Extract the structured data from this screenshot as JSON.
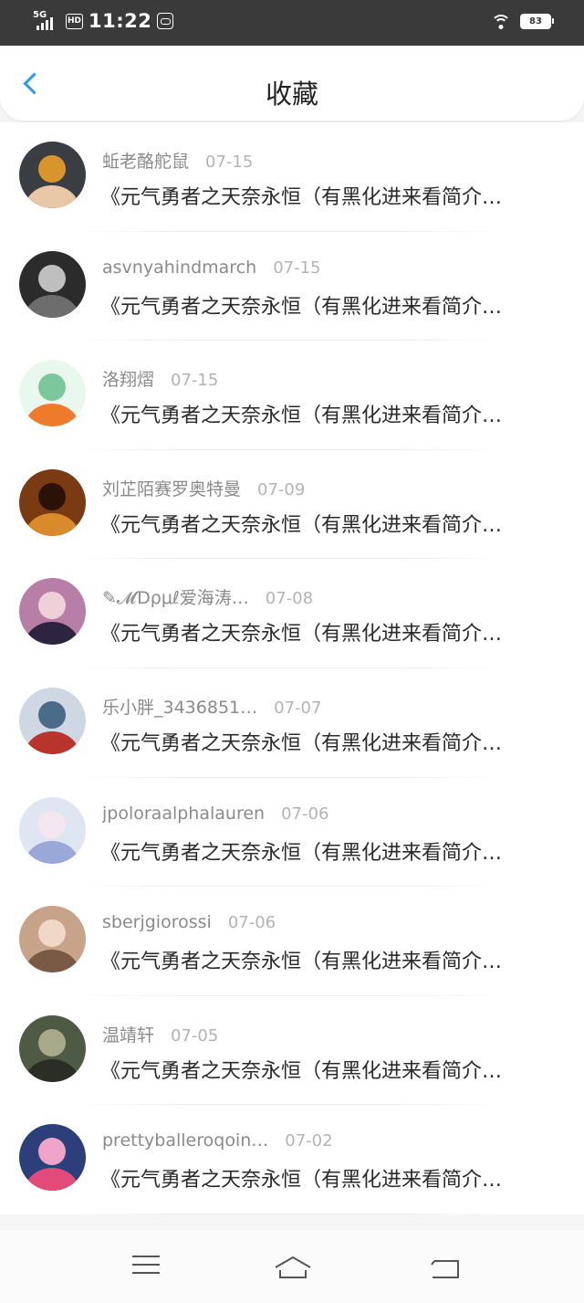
{
  "status": {
    "network": "5G",
    "hd": "HD",
    "time": "11:22",
    "battery": "83"
  },
  "header": {
    "title": "收藏"
  },
  "items": [
    {
      "name": "蚯老酪舵鼠",
      "date": "07-15",
      "text": "《元气勇者之天奈永恒（有黑化进来看简介…",
      "avatar_colors": [
        "#3a3d42",
        "#e8c7a6",
        "#d9952c"
      ]
    },
    {
      "name": "asvnyahindmarch",
      "date": "07-15",
      "text": "《元气勇者之天奈永恒（有黑化进来看简介…",
      "avatar_colors": [
        "#2b2b2b",
        "#6d6d6d",
        "#bfbfbf"
      ]
    },
    {
      "name": "洛翔熠",
      "date": "07-15",
      "text": "《元气勇者之天奈永恒（有黑化进来看简介…",
      "avatar_colors": [
        "#eaf7ef",
        "#f07a2b",
        "#7dc79d"
      ]
    },
    {
      "name": "刘芷陌赛罗奥特曼",
      "date": "07-09",
      "text": "《元气勇者之天奈永恒（有黑化进来看简介…",
      "avatar_colors": [
        "#7a3b12",
        "#d98a2b",
        "#2a1306"
      ]
    },
    {
      "name": "✎𝓜Ɗρμℓ爱海涛…",
      "date": "07-08",
      "text": "《元气勇者之天奈永恒（有黑化进来看简介…",
      "avatar_colors": [
        "#b77ea8",
        "#2d2440",
        "#f0d0d8"
      ]
    },
    {
      "name": "乐小胖_3436851…",
      "date": "07-07",
      "text": "《元气勇者之天奈永恒（有黑化进来看简介…",
      "avatar_colors": [
        "#cfd8e2",
        "#b8342c",
        "#4a6a8a"
      ]
    },
    {
      "name": "jpoloraalphalauren",
      "date": "07-06",
      "text": "《元气勇者之天奈永恒（有黑化进来看简介…",
      "avatar_colors": [
        "#dfe6f2",
        "#9aa8d8",
        "#f3e6ee"
      ]
    },
    {
      "name": "sberjgiorossi",
      "date": "07-06",
      "text": "《元气勇者之天奈永恒（有黑化进来看简介…",
      "avatar_colors": [
        "#c7a38a",
        "#7a5a45",
        "#efd8c8"
      ]
    },
    {
      "name": "温靖轩",
      "date": "07-05",
      "text": "《元气勇者之天奈永恒（有黑化进来看简介…",
      "avatar_colors": [
        "#4f5a45",
        "#2a2e24",
        "#a8a88a"
      ]
    },
    {
      "name": "prettyballeroqoin…",
      "date": "07-02",
      "text": "《元气勇者之天奈永恒（有黑化进来看简介…",
      "avatar_colors": [
        "#2d3f7a",
        "#e24a7a",
        "#f0a3c8"
      ]
    }
  ],
  "icons": {
    "back": "chevron-left-icon",
    "menu": "menu-icon",
    "home": "home-icon",
    "return": "return-icon",
    "wifi": "wifi-icon",
    "battery": "battery-icon",
    "game": "game-icon",
    "signal": "signal-icon"
  },
  "colors": {
    "accent": "#2f9ae8",
    "status_bar": "#3a3a3a"
  }
}
